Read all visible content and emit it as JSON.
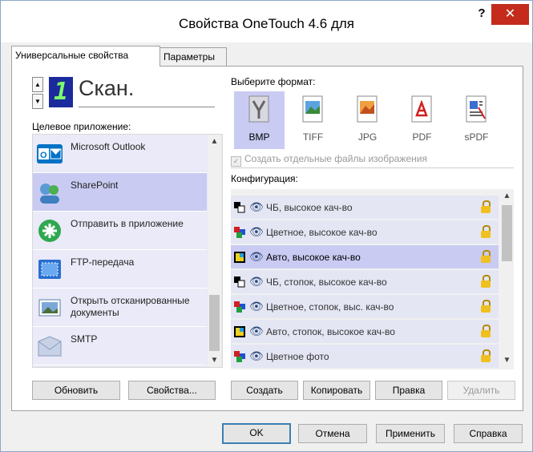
{
  "window": {
    "title": "Свойства OneTouch 4.6 для",
    "help": "?",
    "close": "✕"
  },
  "tabs": [
    "Универсальные свойства",
    "Параметры"
  ],
  "scan": {
    "digit": "1",
    "name": "Скан."
  },
  "destination": {
    "label": "Целевое приложение:",
    "items": [
      {
        "label": "Microsoft Outlook",
        "icon": "outlook-icon",
        "color": "#0072c6"
      },
      {
        "label": "SharePoint",
        "icon": "sharepoint-icon",
        "color": "#3f7fbf"
      },
      {
        "label": "Отправить в приложение",
        "icon": "send-app-icon",
        "color": "#2fa84f"
      },
      {
        "label": "FTP-передача",
        "icon": "ftp-icon",
        "color": "#2a6fd0"
      },
      {
        "label": "Открыть отсканированные документы",
        "icon": "open-docs-icon",
        "color": "#5a7fa8"
      },
      {
        "label": "SMTP",
        "icon": "smtp-icon",
        "color": "#8a9cc0"
      }
    ],
    "selected_index": 1
  },
  "left_buttons": {
    "refresh": "Обновить",
    "properties": "Свойства..."
  },
  "format": {
    "label": "Выберите формат:",
    "items": [
      {
        "label": "BMP",
        "icon": "bmp-icon"
      },
      {
        "label": "TIFF",
        "icon": "tiff-icon"
      },
      {
        "label": "JPG",
        "icon": "jpg-icon"
      },
      {
        "label": "PDF",
        "icon": "pdf-icon"
      },
      {
        "label": "sPDF",
        "icon": "spdf-icon"
      }
    ],
    "selected_index": 0
  },
  "separate_files": {
    "label": "Создать отдельные файлы изображения",
    "checked": true,
    "disabled": true
  },
  "configuration": {
    "label": "Конфигурация:",
    "items": [
      {
        "label": "ЧБ, высокое кач-во",
        "icon": "bw-icon"
      },
      {
        "label": "Цветное, высокое кач-во",
        "icon": "color-icon"
      },
      {
        "label": "Авто, высокое кач-во",
        "icon": "auto-icon"
      },
      {
        "label": "ЧБ, стопок, высокое кач-во",
        "icon": "bw-icon"
      },
      {
        "label": "Цветное, стопок, выс. кач-во",
        "icon": "color-icon"
      },
      {
        "label": "Авто, стопок, высокое кач-во",
        "icon": "auto-icon"
      },
      {
        "label": "Цветное фото",
        "icon": "color-icon"
      }
    ],
    "selected_index": 2
  },
  "config_buttons": {
    "create": "Создать",
    "copy": "Копировать",
    "edit": "Правка",
    "delete": "Удалить"
  },
  "dialog_buttons": {
    "ok": "OK",
    "cancel": "Отмена",
    "apply": "Применить",
    "help": "Справка"
  },
  "colors": {
    "selection": "#c9cbf3",
    "list_bg": "#eaeaf8",
    "close": "#c42b1c"
  }
}
